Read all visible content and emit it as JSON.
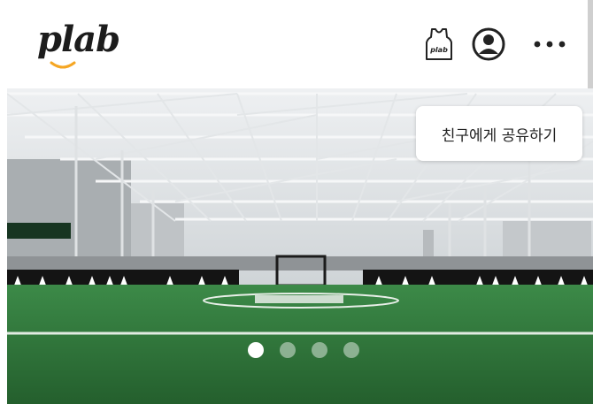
{
  "header": {
    "logo_text": "plab",
    "icons": {
      "jersey": "jersey-icon",
      "profile": "profile-icon",
      "more": "more-dots-icon"
    }
  },
  "hero": {
    "share_label": "친구에게 공유하기",
    "banner_text": "",
    "carousel": {
      "total": 4,
      "active_index": 0
    }
  },
  "colors": {
    "brand_accent": "#f5a623",
    "turf": "#2f7a3c",
    "text_dark": "#1c1c1c"
  }
}
